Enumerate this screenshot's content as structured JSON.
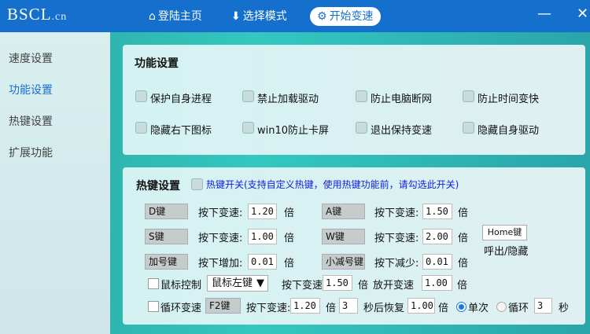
{
  "header": {
    "logo_main": "BSCL",
    "logo_suffix": ".cn",
    "nav": [
      {
        "label": "登陆主页",
        "icon": "home-icon"
      },
      {
        "label": "选择模式",
        "icon": "download-icon"
      },
      {
        "label": "开始变速",
        "icon": "gear-icon",
        "active": true
      }
    ],
    "minimize": "—",
    "close": "✕"
  },
  "sidebar": {
    "items": [
      {
        "label": "速度设置"
      },
      {
        "label": "功能设置",
        "active": true
      },
      {
        "label": "热键设置"
      },
      {
        "label": "扩展功能"
      }
    ]
  },
  "function_panel": {
    "title": "功能设置",
    "options": [
      "保护自身进程",
      "禁止加载驱动",
      "防止电脑断网",
      "防止时间变快",
      "隐藏右下图标",
      "win10防止卡屏",
      "退出保持变速",
      "隐藏自身驱动"
    ]
  },
  "hotkey_panel": {
    "title": "热键设置",
    "toggle_label": "热键开关(支持自定义热键，使用热键功能前，请勾选此开关)",
    "rows": [
      {
        "key1": "D键",
        "label1": "按下变速:",
        "val1": "1.20",
        "key2": "A键",
        "label2": "按下变速:",
        "val2": "1.50"
      },
      {
        "key1": "S键",
        "label1": "按下变速:",
        "val1": "1.00",
        "key2": "W键",
        "label2": "按下变速:",
        "val2": "2.00"
      },
      {
        "key1": "加号键",
        "label1": "按下增加:",
        "val1": "0.01",
        "key2": "小减号键",
        "label2": "按下减少:",
        "val2": "0.01"
      }
    ],
    "unit": "倍",
    "home_key": "Home键",
    "home_label": "呼出/隐藏",
    "mouse": {
      "label": "鼠标控制",
      "select": "鼠标左键",
      "press_label": "按下变速",
      "press_val": "1.50",
      "release_label": "放开变速",
      "release_val": "1.00"
    },
    "loop": {
      "label": "循环变速",
      "key": "F2键",
      "press_label": "按下变速:",
      "press_val": "1.20",
      "secs": "3",
      "restore_label": "秒后恢复",
      "restore_val": "1.00",
      "once": "单次",
      "cycle": "循环",
      "cycle_val": "3",
      "sec_unit": "秒"
    }
  },
  "accent": "#1470cc"
}
